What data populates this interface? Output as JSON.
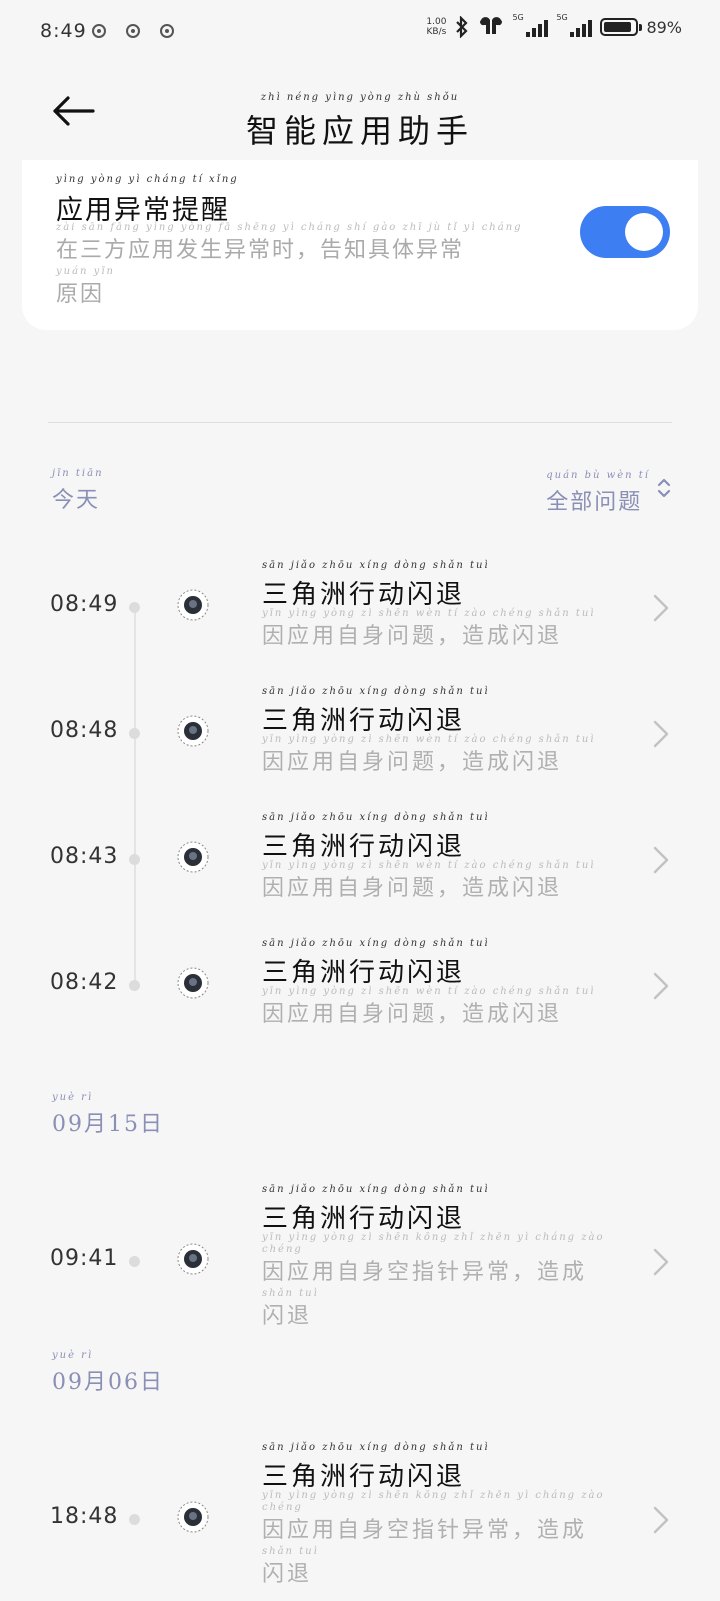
{
  "status_bar": {
    "time": "8:49",
    "net_speed": "1.00",
    "net_unit": "KB/s",
    "signal_tag_1": "5G",
    "signal_tag_2": "5G",
    "battery_percent": "89",
    "battery_level": 0.89
  },
  "header": {
    "title_pinyin": "zhì néng yìng yòng zhù shǒu",
    "title": "智能应用助手"
  },
  "toggle_card": {
    "title_pinyin": "yìng yòng yì cháng tí xǐng",
    "title": "应用异常提醒",
    "desc_pinyin": "zài sān fāng yìng yòng fā shēng yì cháng shí gào zhī jù tǐ yì cháng",
    "desc": "在三方应用发生异常时，告知具体异常",
    "desc2_pinyin": "yuán yīn",
    "desc2": "原因",
    "enabled": true,
    "accent_color": "#3d7ff2"
  },
  "filter": {
    "pinyin": "quán bù wèn tí",
    "label": "全部问题"
  },
  "sections": [
    {
      "label_pinyin": "jīn tiān",
      "label": "今天",
      "items": [
        {
          "time": "08:49",
          "title_pinyin": "sān jiǎo zhōu xíng dòng shǎn tuì",
          "title": "三角洲行动闪退",
          "sub_pinyin": "yīn yìng yòng zì shēn wèn tí zào chéng shǎn tuì",
          "sub": "因应用自身问题，造成闪退",
          "sub2_pinyin": "",
          "sub2": ""
        },
        {
          "time": "08:48",
          "title_pinyin": "sān jiǎo zhōu xíng dòng shǎn tuì",
          "title": "三角洲行动闪退",
          "sub_pinyin": "yīn yìng yòng zì shēn wèn tí zào chéng shǎn tuì",
          "sub": "因应用自身问题，造成闪退",
          "sub2_pinyin": "",
          "sub2": ""
        },
        {
          "time": "08:43",
          "title_pinyin": "sān jiǎo zhōu xíng dòng shǎn tuì",
          "title": "三角洲行动闪退",
          "sub_pinyin": "yīn yìng yòng zì shēn wèn tí zào chéng shǎn tuì",
          "sub": "因应用自身问题，造成闪退",
          "sub2_pinyin": "",
          "sub2": ""
        },
        {
          "time": "08:42",
          "title_pinyin": "sān jiǎo zhōu xíng dòng shǎn tuì",
          "title": "三角洲行动闪退",
          "sub_pinyin": "yīn yìng yòng zì shēn wèn tí zào chéng shǎn tuì",
          "sub": "因应用自身问题，造成闪退",
          "sub2_pinyin": "",
          "sub2": ""
        }
      ]
    },
    {
      "label_pinyin": "yuè rì",
      "label": "09月15日",
      "items": [
        {
          "time": "09:41",
          "title_pinyin": "sān jiǎo zhōu xíng dòng shǎn tuì",
          "title": "三角洲行动闪退",
          "sub_pinyin": "yīn yìng yòng zì shēn kōng zhǐ zhēn yì cháng zào chéng",
          "sub": "因应用自身空指针异常，造成",
          "sub2_pinyin": "shǎn tuì",
          "sub2": "闪退"
        }
      ]
    },
    {
      "label_pinyin": "yuè rì",
      "label": "09月06日",
      "items": [
        {
          "time": "18:48",
          "title_pinyin": "sān jiǎo zhōu xíng dòng shǎn tuì",
          "title": "三角洲行动闪退",
          "sub_pinyin": "yīn yìng yòng zì shēn kōng zhǐ zhēn yì cháng zào chéng",
          "sub": "因应用自身空指针异常，造成",
          "sub2_pinyin": "shǎn tuì",
          "sub2": "闪退"
        }
      ]
    }
  ]
}
